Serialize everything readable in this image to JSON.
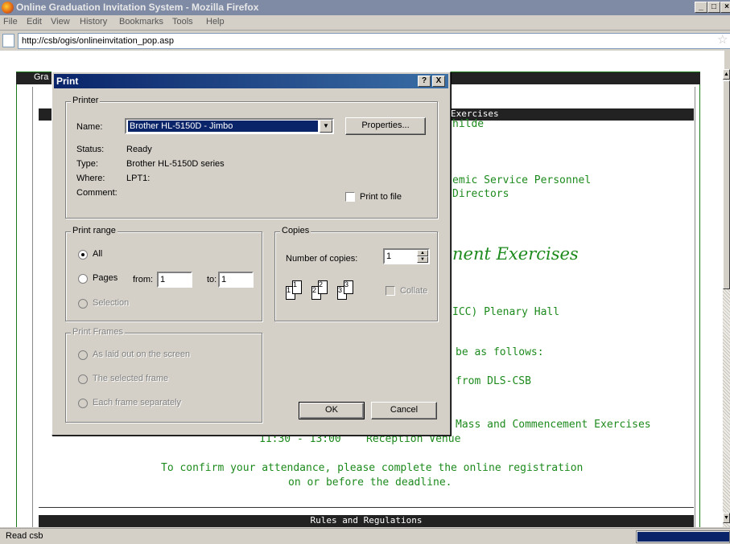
{
  "window": {
    "title": "Online Graduation Invitation System - Mozilla Firefox"
  },
  "menu": [
    "File",
    "Edit",
    "View",
    "History",
    "Bookmarks",
    "Tools",
    "Help"
  ],
  "url": "http://csb/ogis/onlineinvitation_pop.asp",
  "page": {
    "header_partial": "Gra",
    "bar1_text": "Exercises",
    "line_hilde": "hilde",
    "line_service": "emic Service Personnel",
    "line_directors": "Directors",
    "script_title": "nent Exercises",
    "line_venue": "ICC) Plenary Hall",
    "line_follows": "be as follows:",
    "line_from": "from DLS-CSB",
    "line_mass": "Mass and Commencement Exercises",
    "schedule_time": "11:30 - 13:00",
    "schedule_event": "Reception Venue",
    "confirm_line1": "To confirm your attendance, please complete the online registration",
    "confirm_line2": "on or before the deadline.",
    "rules_bar": "Rules and Regulations"
  },
  "status": {
    "text": "Read csb"
  },
  "print_dialog": {
    "title": "Print",
    "help_btn": "?",
    "close_btn": "X",
    "printer": {
      "legend": "Printer",
      "name_label": "Name:",
      "name_value": "Brother HL-5150D - Jimbo",
      "properties_label": "Properties...",
      "status_label": "Status:",
      "status_value": "Ready",
      "type_label": "Type:",
      "type_value": "Brother HL-5150D series",
      "where_label": "Where:",
      "where_value": "LPT1:",
      "comment_label": "Comment:",
      "print_to_file_label": "Print to file"
    },
    "range": {
      "legend": "Print range",
      "all_label": "All",
      "pages_label": "Pages",
      "from_label": "from:",
      "from_value": "1",
      "to_label": "to:",
      "to_value": "1",
      "selection_label": "Selection"
    },
    "copies": {
      "legend": "Copies",
      "number_label": "Number of copies:",
      "number_value": "1",
      "collate_label": "Collate",
      "stack_numbers": [
        "1",
        "1",
        "2",
        "2",
        "3",
        "3"
      ]
    },
    "frames": {
      "legend": "Print Frames",
      "as_laid_out": "As laid out on the screen",
      "selected_frame": "The selected frame",
      "each_frame": "Each frame separately"
    },
    "ok_label": "OK",
    "cancel_label": "Cancel"
  }
}
